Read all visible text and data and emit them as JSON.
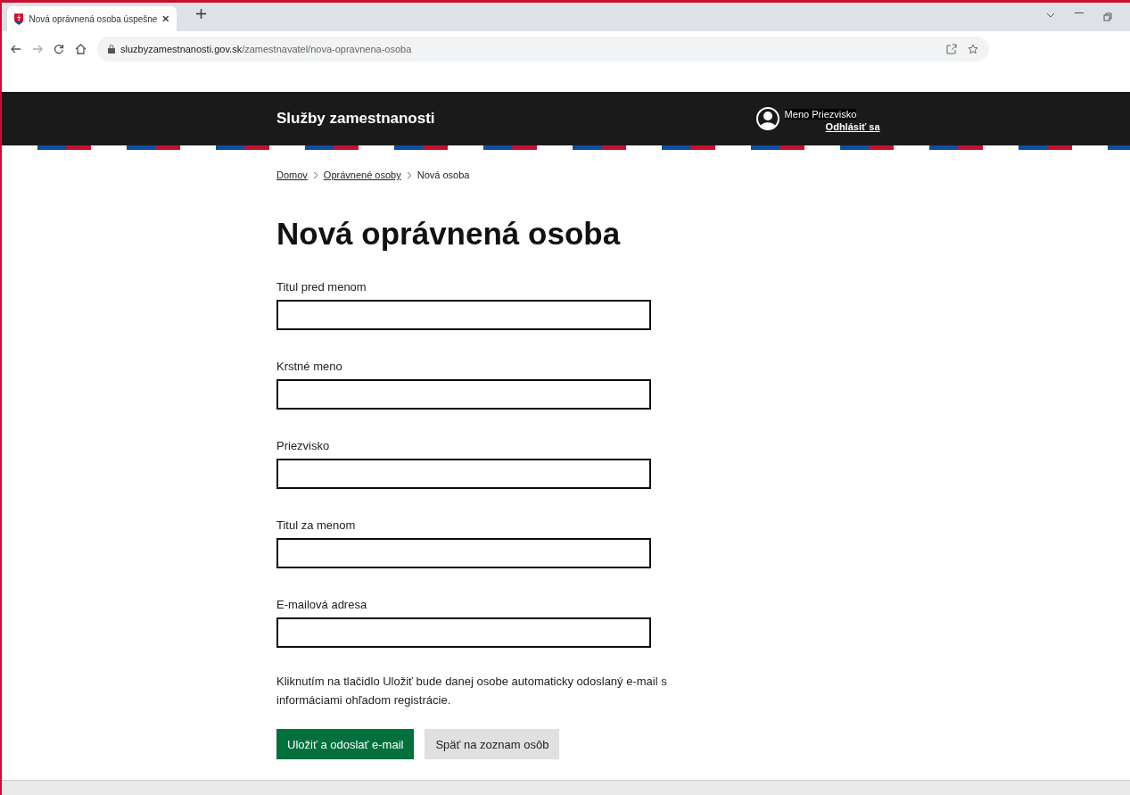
{
  "browser": {
    "tab_title": "Nová oprávnená osoba úspešne",
    "url_host": "sluzbyzamestnanosti.gov.sk",
    "url_path": "/zamestnavatel/nova-opravnena-osoba"
  },
  "header": {
    "site_title": "Služby zamestnanosti",
    "user_name": "Meno Priezvisko",
    "logout": "Odhlásiť sa"
  },
  "breadcrumbs": [
    {
      "label": "Domov",
      "kind": "link"
    },
    {
      "label": "Oprávnené osoby",
      "kind": "link"
    },
    {
      "label": "Nová osoba",
      "kind": "current"
    }
  ],
  "heading": "Nová oprávnená osoba",
  "fields": [
    {
      "label": "Titul pred menom"
    },
    {
      "label": "Krstné meno"
    },
    {
      "label": "Priezvisko"
    },
    {
      "label": "Titul za menom"
    },
    {
      "label": "E-mailová adresa"
    }
  ],
  "note": "Kliknutím na tlačidlo Uložiť bude danej osobe automaticky odoslaný e-mail s informáciami ohľadom registrácie.",
  "buttons": [
    {
      "label": "Uložiť a odoslať e-mail",
      "kind": "primary"
    },
    {
      "label": "Späť na zoznam osôb",
      "kind": "secondary"
    }
  ]
}
